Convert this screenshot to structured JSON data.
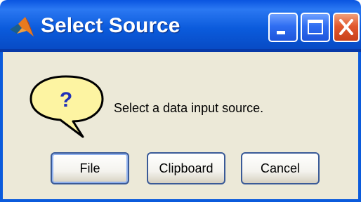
{
  "window": {
    "title": "Select Source",
    "app_icon": "matlab-logo-icon",
    "controls": {
      "minimize_icon": "minimize-icon",
      "maximize_icon": "maximize-icon",
      "close_icon": "close-icon"
    }
  },
  "dialog": {
    "icon": "question-speech-bubble-icon",
    "icon_glyph": "?",
    "message": "Select a data input source."
  },
  "buttons": {
    "file": "File",
    "clipboard": "Clipboard",
    "cancel": "Cancel"
  },
  "colors": {
    "titlebar": "#0b5bdc",
    "client_background": "#ece9d8",
    "close_button": "#e2592e",
    "bubble_fill": "#fdf4a2"
  }
}
